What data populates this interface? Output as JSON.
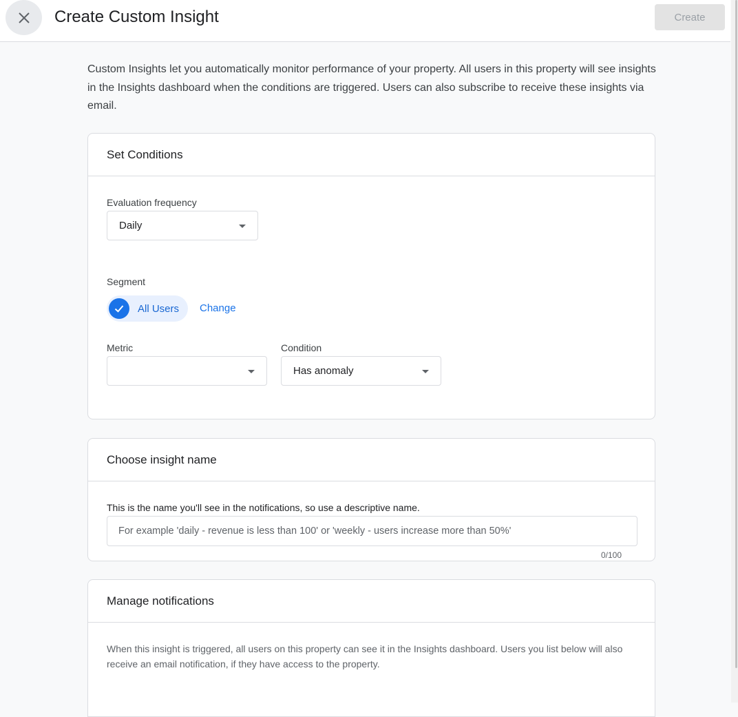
{
  "header": {
    "title": "Create Custom Insight",
    "create_label": "Create",
    "close_icon": "close-icon"
  },
  "intro_text": "Custom Insights let you automatically monitor performance of your property. All users in this property will see insights in the Insights dashboard when the conditions are triggered. Users can also subscribe to receive these insights via email.",
  "conditions": {
    "title": "Set Conditions",
    "frequency_label": "Evaluation frequency",
    "frequency_value": "Daily",
    "segment_label": "Segment",
    "segment_value": "All Users",
    "segment_change": "Change",
    "metric_label": "Metric",
    "metric_value": "",
    "condition_label": "Condition",
    "condition_value": "Has anomaly"
  },
  "insight_name": {
    "title": "Choose insight name",
    "helper": "This is the name you'll see in the notifications, so use a descriptive name.",
    "placeholder": "For example 'daily - revenue is less than 100' or 'weekly - users increase more than 50%'",
    "value": "",
    "counter": "0/100"
  },
  "notifications": {
    "title": "Manage notifications",
    "description": "When this insight is triggered, all users on this property can see it in the Insights dashboard. Users you list below will also receive an email notification, if they have access to the property."
  },
  "colors": {
    "accent": "#1a73e8",
    "chip_bg": "#e8f0fe",
    "border": "#dadce0",
    "background": "#f8f9fa"
  }
}
